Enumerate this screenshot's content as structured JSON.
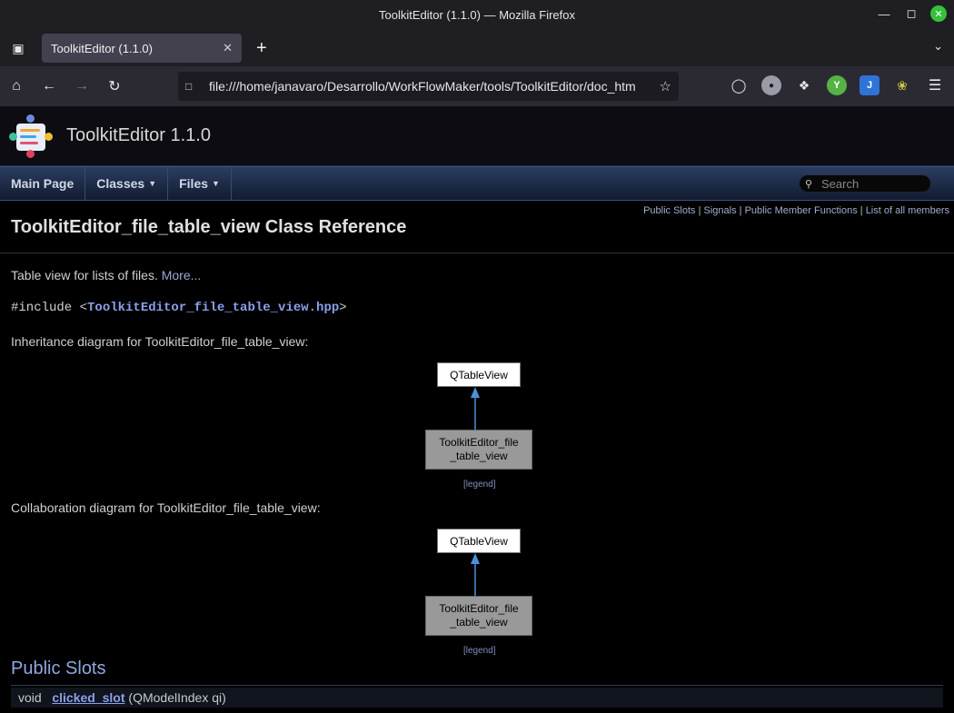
{
  "window": {
    "title": "ToolkitEditor (1.1.0) — Mozilla Firefox"
  },
  "tab": {
    "title": "ToolkitEditor (1.1.0)"
  },
  "address_bar": {
    "url": "file:///home/janavaro/Desarrollo/WorkFlowMaker/tools/ToolkitEditor/doc_htm"
  },
  "doc": {
    "project_name": "ToolkitEditor 1.1.0",
    "menu": {
      "main_page": "Main Page",
      "classes": "Classes",
      "files": "Files"
    },
    "search_placeholder": "Search",
    "summary": {
      "public_slots": "Public Slots",
      "signals": "Signals",
      "public_member_functions": "Public Member Functions",
      "list_all_members": "List of all members",
      "sep": "|"
    },
    "class_title": "ToolkitEditor_file_table_view Class Reference",
    "brief": "Table view for lists of files.",
    "more_link": "More...",
    "include": {
      "prefix": "#include <",
      "file": "ToolkitEditor_file_table_view.hpp",
      "suffix": ">"
    },
    "inheritance_caption": "Inheritance diagram for ToolkitEditor_file_table_view:",
    "collaboration_caption": "Collaboration diagram for ToolkitEditor_file_table_view:",
    "diagram_nodes": {
      "base": "QTableView",
      "derived_line1": "ToolkitEditor_file",
      "derived_line2": "_table_view"
    },
    "legend": "[legend]",
    "section_public_slots": "Public Slots",
    "member_first": {
      "type": "void",
      "name": "clicked_slot",
      "args": "(QModelIndex qi)"
    }
  }
}
